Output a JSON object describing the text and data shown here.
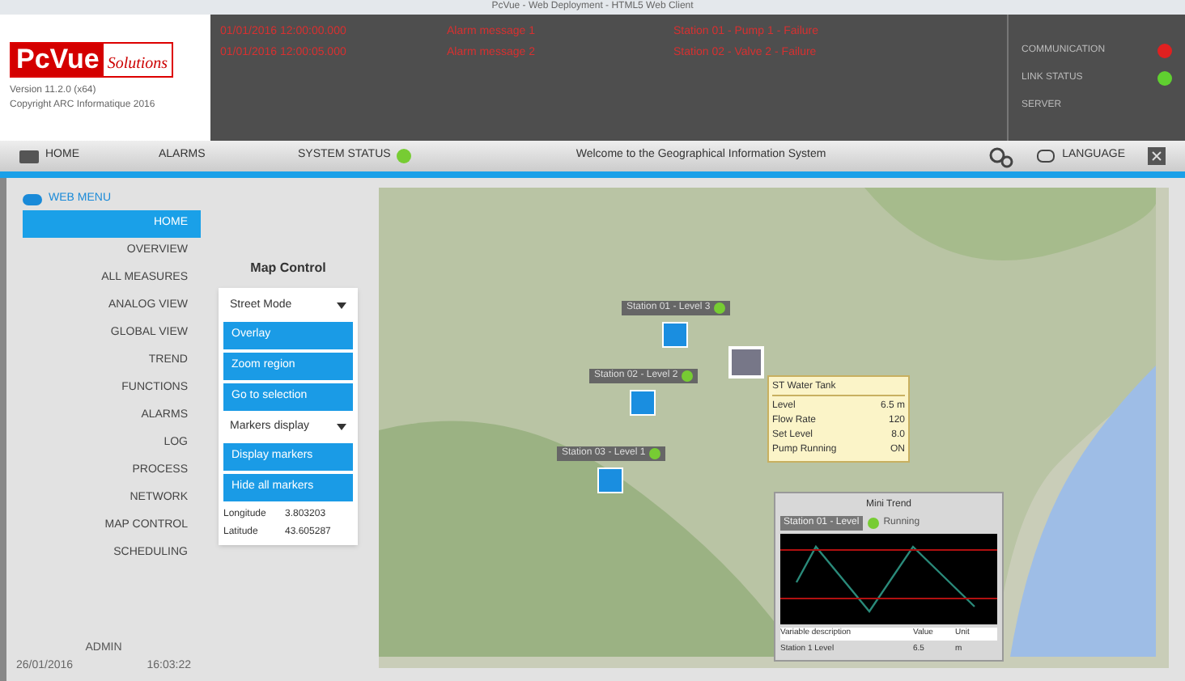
{
  "window": {
    "title": "PcVue - Web Deployment - HTML5 Web Client"
  },
  "header": {
    "logo_main": "PcVue",
    "logo_sub": "Solutions",
    "version": "Version 11.2.0 (x64)",
    "copyright": "Copyright ARC Informatique 2016",
    "alarm_lines": [
      {
        "cells": [
          "01/01/2016 12:00:00.000",
          "Alarm message 1",
          "Station 01 - Pump 1 - Failure"
        ]
      },
      {
        "cells": [
          "01/01/2016 12:00:05.000",
          "Alarm message 2",
          "Station 02 - Valve 2 - Failure"
        ]
      }
    ],
    "indicators": [
      {
        "label": "COMMUNICATION",
        "color": "#e02020"
      },
      {
        "label": "LINK STATUS",
        "color": "#60d030"
      },
      {
        "label": "SERVER"
      }
    ]
  },
  "toolbar": {
    "items": [
      {
        "label": "HOME",
        "kind": "icon"
      },
      {
        "label": "ALARMS",
        "kind": "plain"
      },
      {
        "label": "SYSTEM STATUS",
        "kind": "status"
      }
    ],
    "message": "Welcome to the Geographical Information System",
    "language": "LANGUAGE"
  },
  "sidebar": {
    "title": "WEB MENU",
    "items": [
      {
        "label": "HOME",
        "selected": true
      },
      {
        "label": "OVERVIEW",
        "selected": false
      },
      {
        "label": "ALL MEASURES",
        "selected": false
      },
      {
        "label": "ANALOG VIEW",
        "selected": false
      },
      {
        "label": "GLOBAL VIEW",
        "selected": false
      },
      {
        "label": "TREND",
        "selected": false
      },
      {
        "label": "FUNCTIONS",
        "selected": false
      },
      {
        "label": "ALARMS",
        "selected": false
      },
      {
        "label": "LOG",
        "selected": false
      },
      {
        "label": "PROCESS",
        "selected": false
      },
      {
        "label": "NETWORK",
        "selected": false
      },
      {
        "label": "MAP CONTROL",
        "selected": false
      },
      {
        "label": "SCHEDULING",
        "selected": false
      }
    ],
    "footer": "ADMIN",
    "date": "26/01/2016",
    "time": "16:03:22"
  },
  "map_control": {
    "title": "Map Control",
    "controls": [
      {
        "kind": "select",
        "label": "Street Mode"
      },
      {
        "kind": "button",
        "label": "Overlay"
      },
      {
        "kind": "button",
        "label": "Zoom region"
      },
      {
        "kind": "button",
        "label": "Go to selection"
      },
      {
        "kind": "select",
        "label": "Markers display"
      },
      {
        "kind": "button",
        "label": "Display markers"
      },
      {
        "kind": "button",
        "label": "Hide all markers"
      }
    ],
    "longitude_label": "Longitude",
    "longitude": "3.803203",
    "latitude_label": "Latitude",
    "latitude": "43.605287"
  },
  "map": {
    "markers": [
      {
        "label": "Station 01 - Level 3"
      },
      {
        "label": "Station 02 - Level 2"
      },
      {
        "label": "Station 03 - Level 1"
      }
    ],
    "tooltip": {
      "title": "ST Water Tank",
      "rows": [
        {
          "name": "Level",
          "value": "6.5 m"
        },
        {
          "name": "Flow Rate",
          "value": "120"
        },
        {
          "name": "Set Level",
          "value": "8.0"
        },
        {
          "name": "Pump Running",
          "value": "ON"
        }
      ]
    },
    "trend": {
      "title": "Mini Trend",
      "header": "Station 01 - Level",
      "status": "Running",
      "columns": [
        "Variable description",
        "Value",
        "Unit"
      ],
      "row": [
        "Station 1 Level",
        "6.5",
        "m"
      ]
    }
  }
}
